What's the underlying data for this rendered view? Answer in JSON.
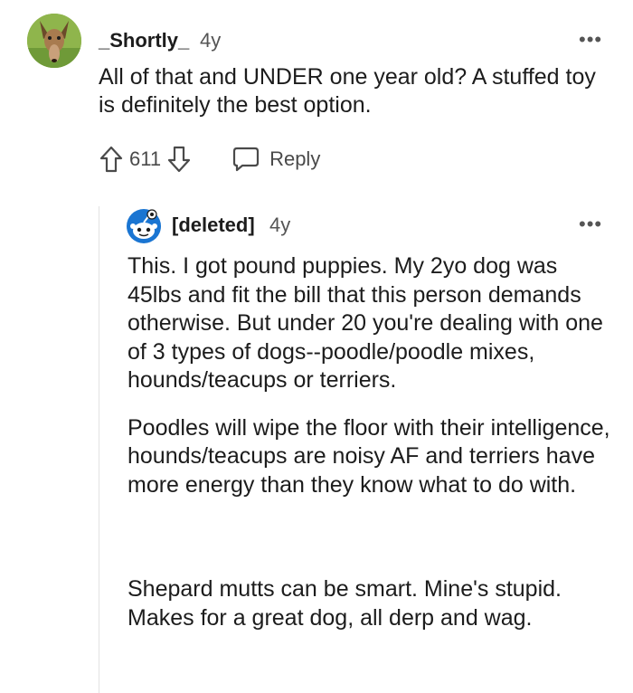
{
  "comment": {
    "username": "_Shortly_",
    "age": "4y",
    "more_label": "•••",
    "body": "All of that and UNDER one year old? A stuffed toy is definitely the best option.",
    "upvote_count": "611",
    "reply_label": "Reply"
  },
  "reply": {
    "username": "[deleted]",
    "age": "4y",
    "more_label": "•••",
    "paragraphs": [
      "This. I got pound puppies. My 2yo dog was 45lbs and fit the bill that this person demands otherwise. But under 20 you're dealing with one of 3 types of dogs--poodle/poodle mixes, hounds/teacups or terriers.",
      "Poodles will wipe the floor with their intelligence, hounds/teacups are noisy AF and terriers have more energy than they know what to do with.",
      "Shepard mutts can be smart. Mine's stupid. Makes for a great dog, all derp and wag."
    ]
  },
  "colors": {
    "text": "#1c1c1c",
    "muted": "#555555",
    "thread_line": "#e2e2e2",
    "avatar_reply": "#1a75d2"
  },
  "icons": {
    "upvote": "arrow-up-outline-icon",
    "downvote": "arrow-down-outline-icon",
    "reply": "speech-bubble-icon",
    "more": "ellipsis-icon"
  }
}
